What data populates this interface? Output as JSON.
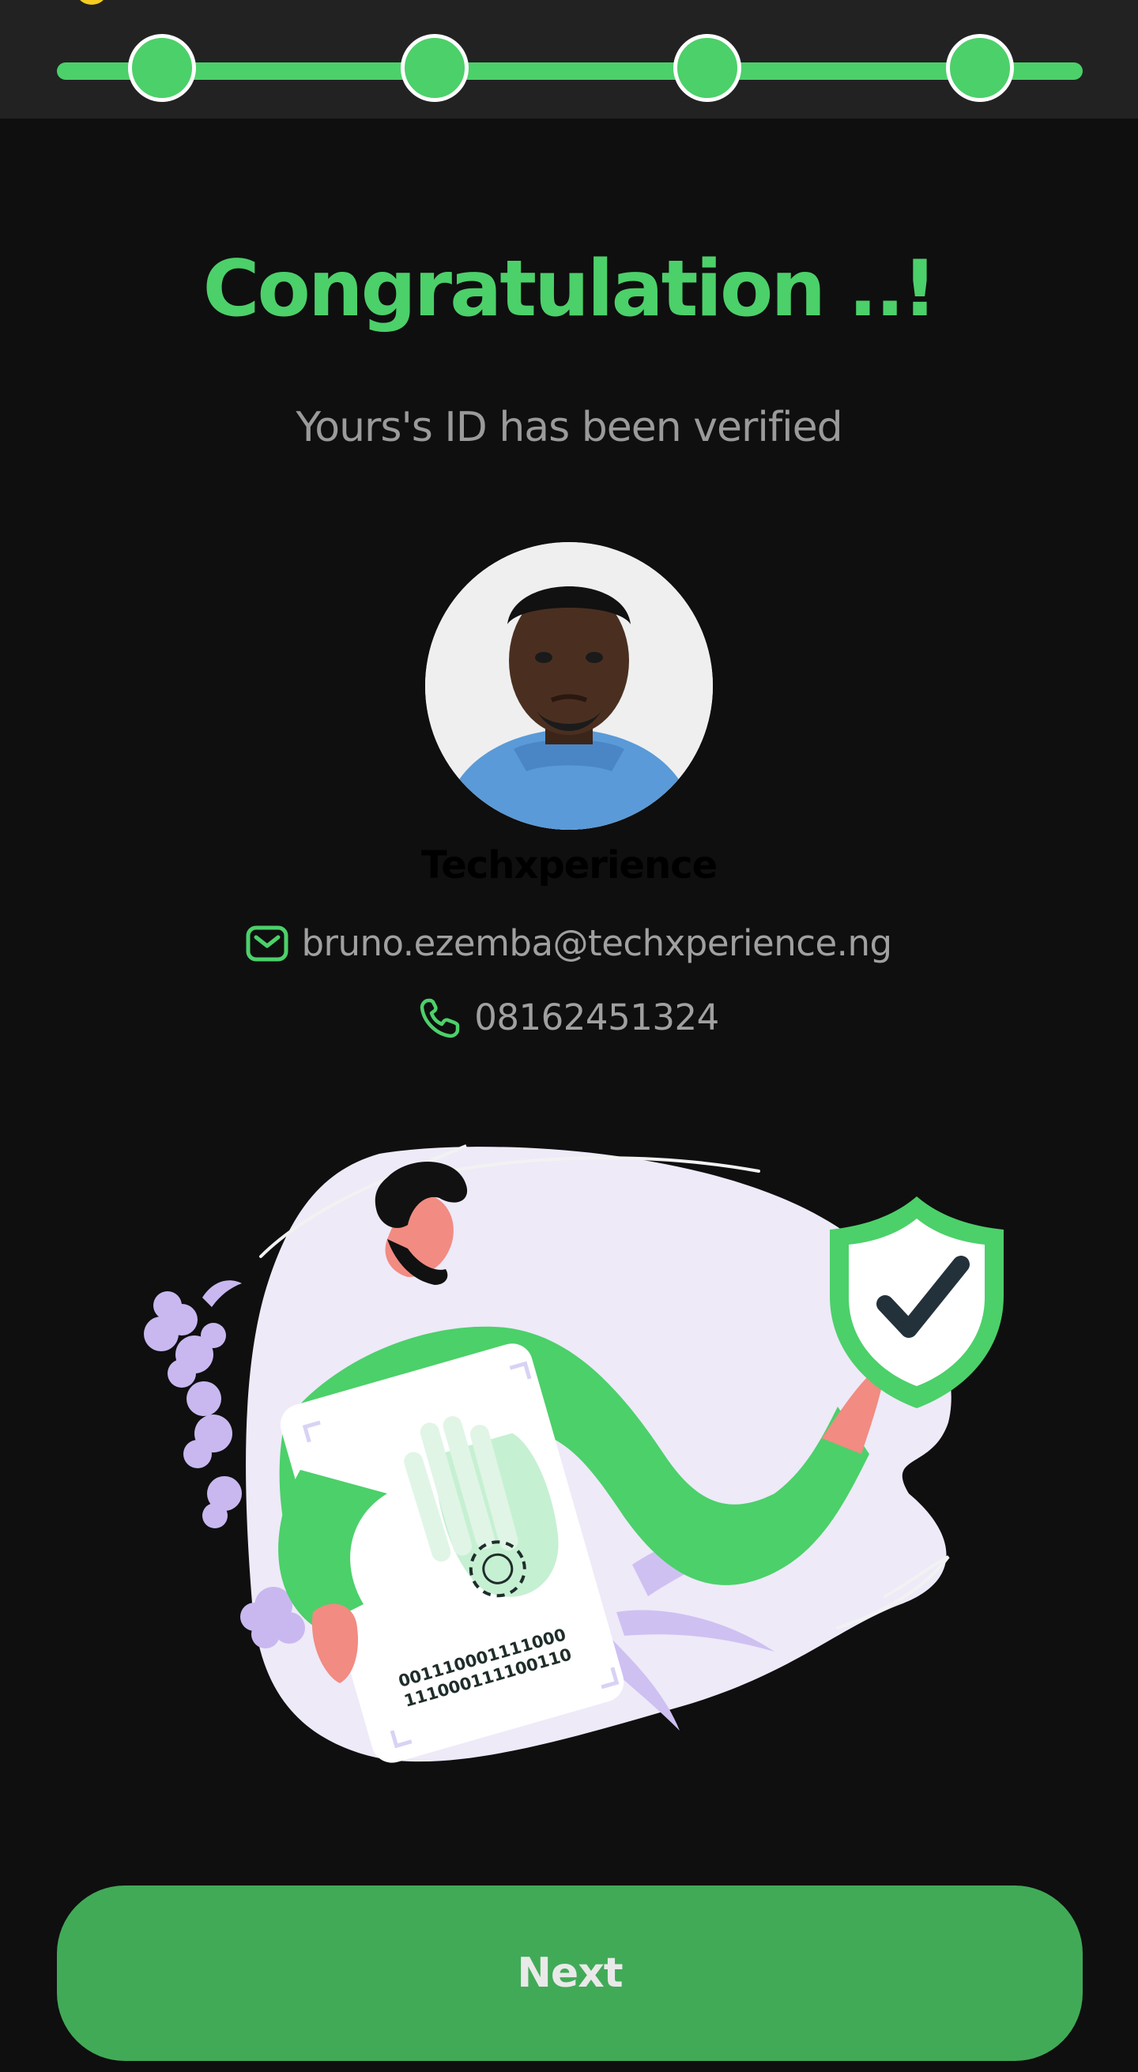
{
  "progress": {
    "total_steps": 4,
    "completed_steps": 4
  },
  "header": {
    "title": "Congratulation ..!",
    "subtitle": "Yours's ID has been verified"
  },
  "profile": {
    "name": "Techxperience",
    "email": "bruno.ezemba@techxperience.ng",
    "phone": "08162451324"
  },
  "illustration": {
    "card_code_line1": "001110001111000",
    "card_code_line2": "111000111100110"
  },
  "actions": {
    "next_label": "Next"
  },
  "colors": {
    "accent": "#4cd06a",
    "button": "#41aa57",
    "background": "#0f0f0f",
    "topbar": "#222222"
  },
  "icons": {
    "email": "mail-icon",
    "phone": "phone-icon",
    "badge": "shield-check-icon"
  }
}
